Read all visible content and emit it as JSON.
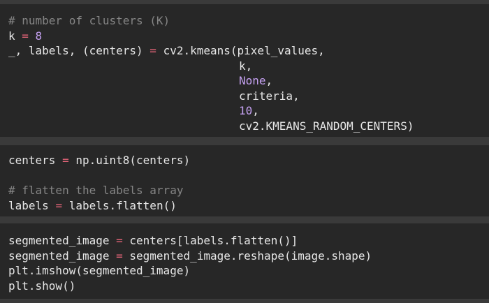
{
  "cells": [
    {
      "lines": [
        [
          {
            "t": "# number of clusters (K)",
            "c": "c"
          }
        ],
        [
          {
            "t": "k "
          },
          {
            "t": "=",
            "c": "o"
          },
          {
            "t": " "
          },
          {
            "t": "8",
            "c": "k"
          }
        ],
        [
          {
            "t": "_, labels, (centers) "
          },
          {
            "t": "=",
            "c": "o"
          },
          {
            "t": " cv2.kmeans(pixel_values,"
          }
        ],
        [
          {
            "ind": true
          },
          {
            "t": "k,"
          }
        ],
        [
          {
            "ind": true
          },
          {
            "t": "None",
            "c": "k"
          },
          {
            "t": ","
          }
        ],
        [
          {
            "ind": true
          },
          {
            "t": "criteria,"
          }
        ],
        [
          {
            "ind": true
          },
          {
            "t": "10",
            "c": "k"
          },
          {
            "t": ","
          }
        ],
        [
          {
            "ind": true
          },
          {
            "t": "cv2.KMEANS_RANDOM_CENTERS)"
          }
        ]
      ]
    },
    {
      "lines": [
        [
          {
            "t": "centers "
          },
          {
            "t": "=",
            "c": "o"
          },
          {
            "t": " np.uint8(centers)"
          }
        ],
        [],
        [
          {
            "t": "# flatten the labels array",
            "c": "c"
          }
        ],
        [
          {
            "t": "labels "
          },
          {
            "t": "=",
            "c": "o"
          },
          {
            "t": " labels.flatten()"
          }
        ]
      ]
    },
    {
      "lines": [
        [
          {
            "t": "segmented_image "
          },
          {
            "t": "=",
            "c": "o"
          },
          {
            "t": " centers[labels.flatten()]"
          }
        ],
        [
          {
            "t": "segmented_image "
          },
          {
            "t": "=",
            "c": "o"
          },
          {
            "t": " segmented_image.reshape(image.shape)"
          }
        ],
        [
          {
            "t": "plt.imshow(segmented_image)"
          }
        ],
        [
          {
            "t": "plt.show()"
          }
        ]
      ]
    }
  ],
  "colors": {
    "background": "#3a3a3a",
    "cell_background": "#272727",
    "text": "#e6e6e6",
    "comment": "#858585",
    "keyword_number": "#c4a0f0",
    "operator": "#e8667a"
  }
}
